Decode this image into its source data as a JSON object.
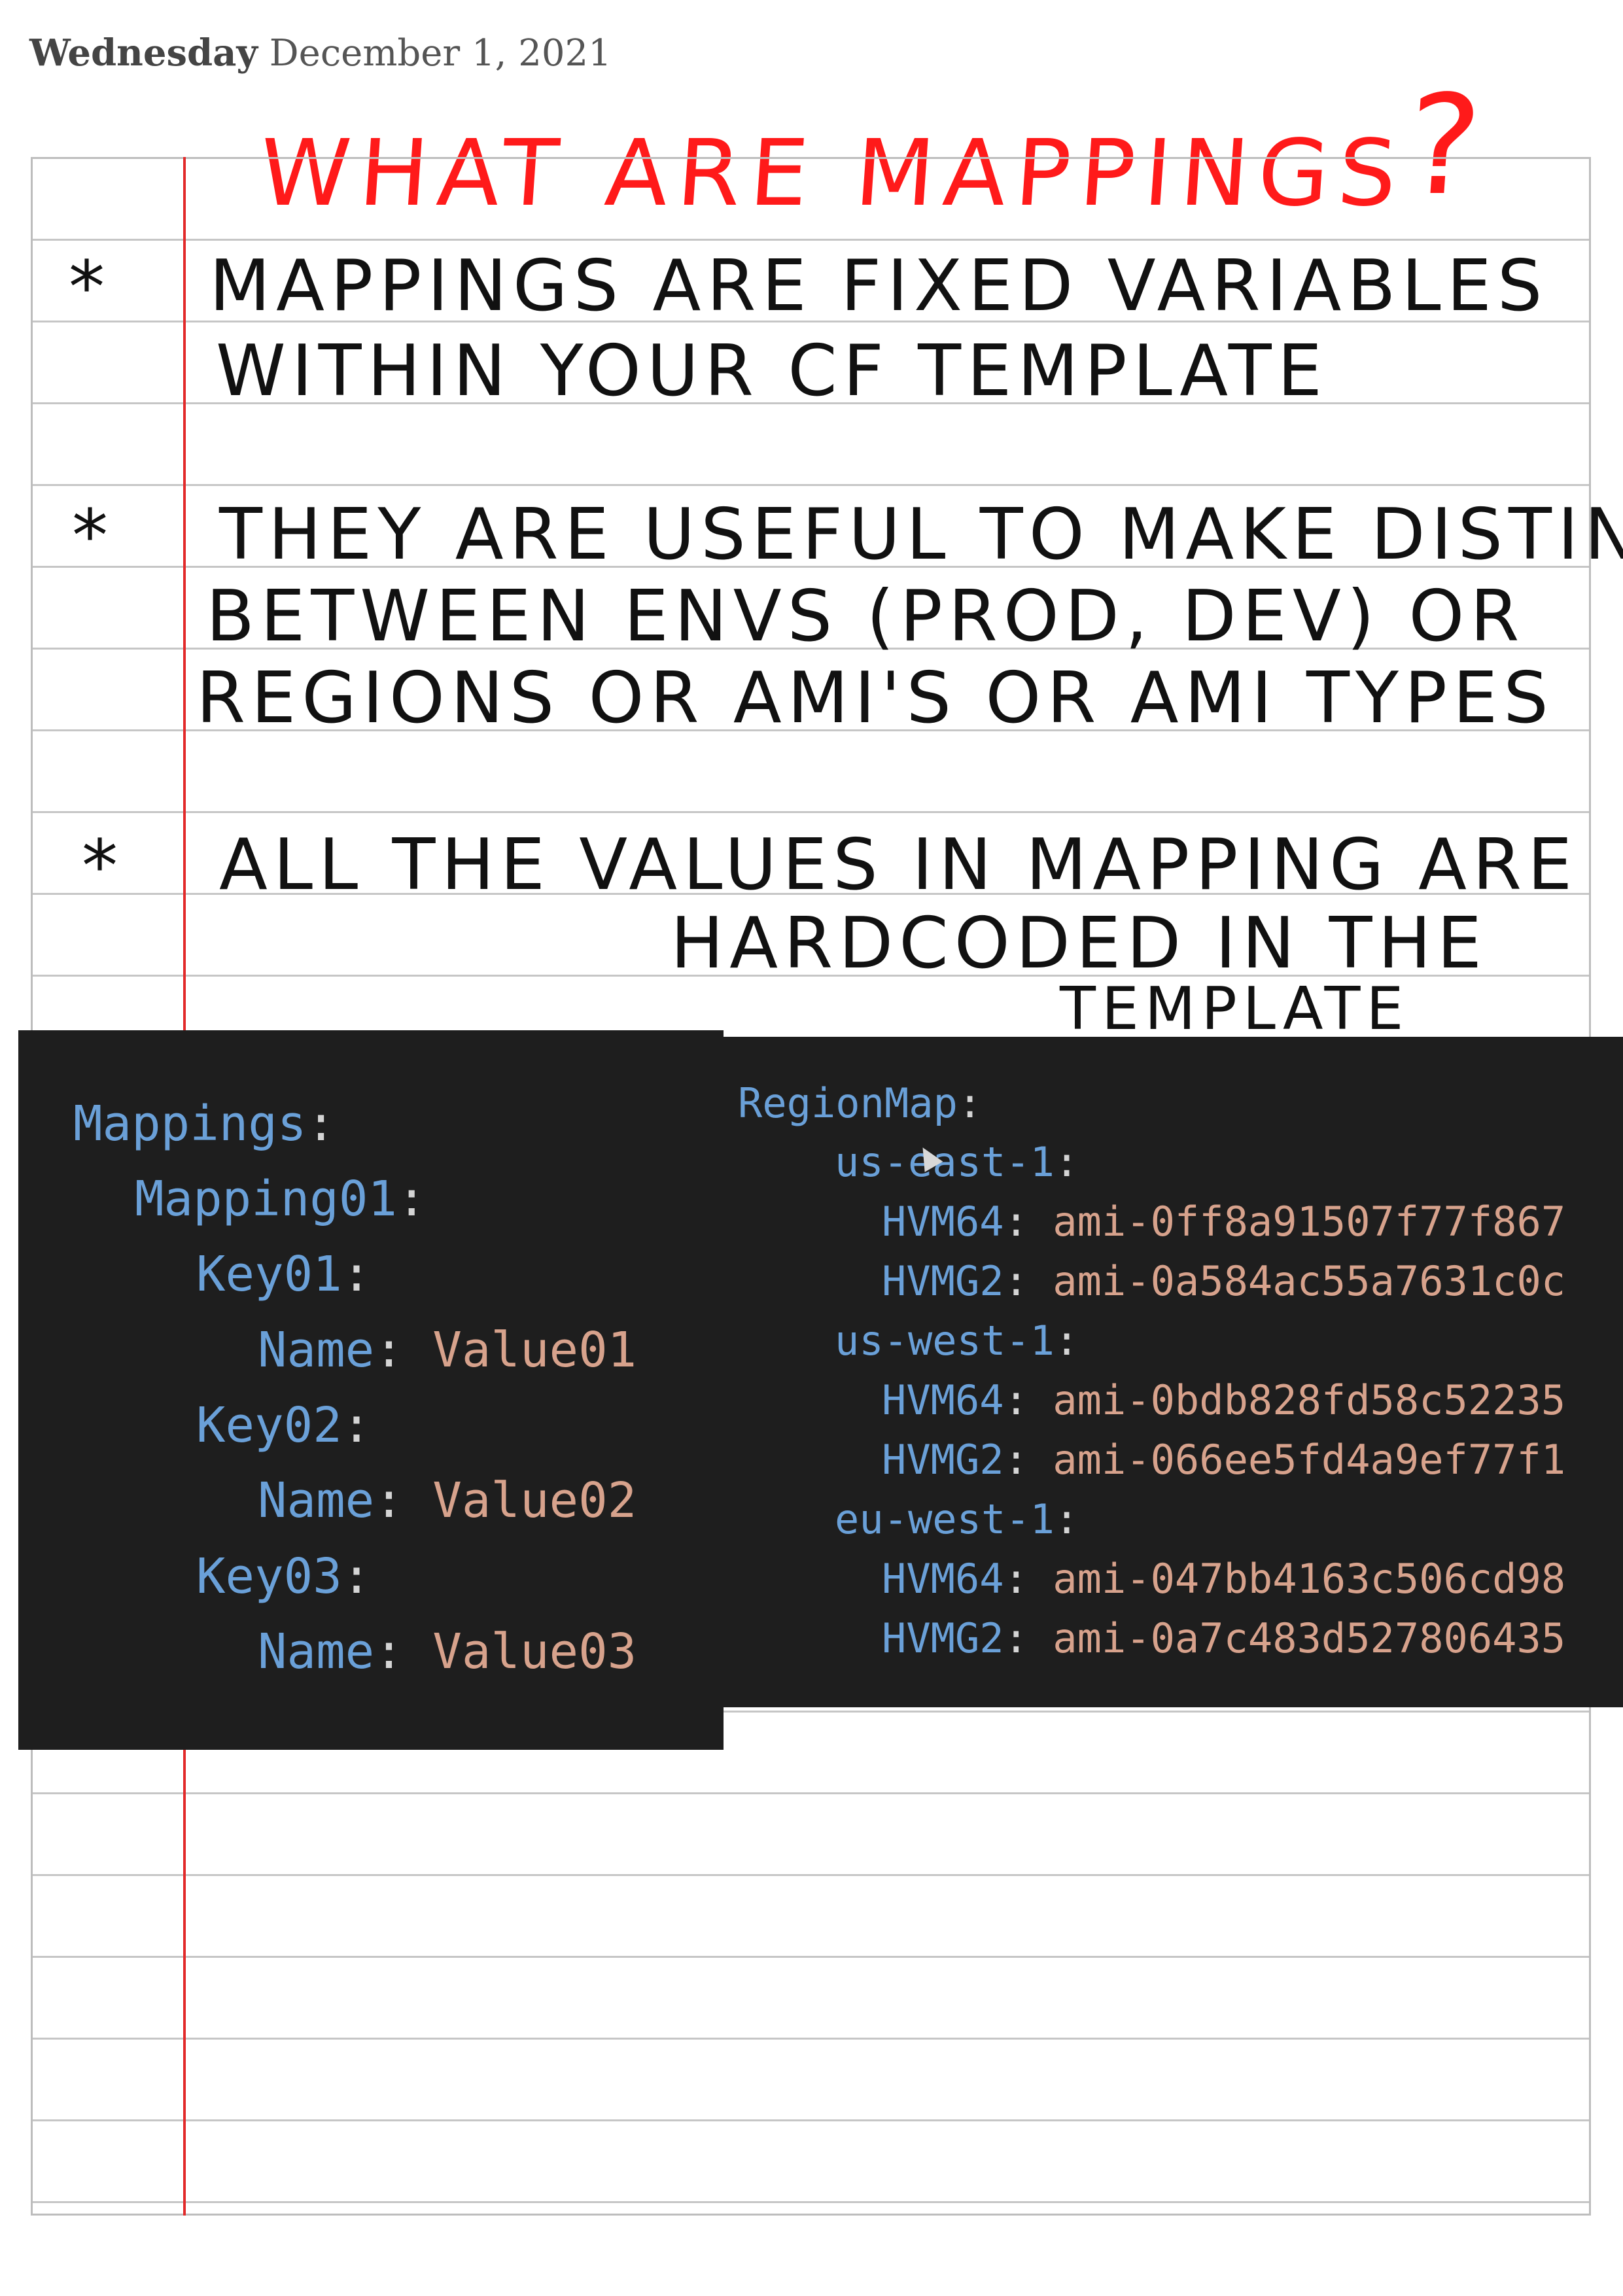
{
  "header": {
    "day": "Wednesday",
    "date": "December 1, 2021",
    "title_text": "WHAT ARE MAPPINGS",
    "title_mark": "?"
  },
  "notes": [
    {
      "bullet": "*",
      "lines": [
        "MAPPINGS ARE FIXED VARIABLES",
        "WITHIN YOUR CF TEMPLATE"
      ]
    },
    {
      "bullet": "*",
      "lines": [
        "THEY ARE USEFUL TO MAKE DISTINK",
        "BETWEEN ENVS (PROD, DEV) OR",
        "REGIONS OR AMI'S OR AMI TYPES"
      ]
    },
    {
      "bullet": "*",
      "lines": [
        "ALL THE VALUES IN MAPPING ARE",
        "HARDCODED IN THE",
        "TEMPLATE"
      ]
    }
  ],
  "code_left": {
    "mappings": "Mappings",
    "mapping01": "Mapping01",
    "key01": "Key01",
    "key02": "Key02",
    "key03": "Key03",
    "name": "Name",
    "value01": "Value01",
    "value02": "Value02",
    "value03": "Value03"
  },
  "code_right": {
    "region_map": "RegionMap",
    "regions": [
      {
        "name": "us-east-1",
        "hvm64": "ami-0ff8a91507f77f867",
        "hvmg2": "ami-0a584ac55a7631c0c"
      },
      {
        "name": "us-west-1",
        "hvm64": "ami-0bdb828fd58c52235",
        "hvmg2": "ami-066ee5fd4a9ef77f1"
      },
      {
        "name": "eu-west-1",
        "hvm64": "ami-047bb4163c506cd98",
        "hvmg2": "ami-0a7c483d527806435"
      }
    ],
    "hvm64_key": "HVM64",
    "hvmg2_key": "HVMG2"
  },
  "colors": {
    "title_red": "#ff1a1a",
    "margin_red": "#e22a2a",
    "code_bg": "#1e1e1e",
    "code_key": "#6aa0d8",
    "code_value": "#d7a28c"
  }
}
